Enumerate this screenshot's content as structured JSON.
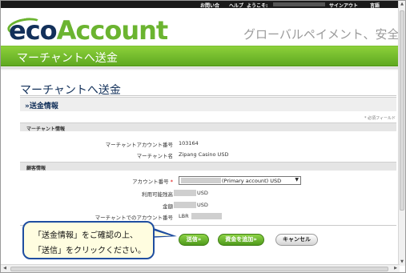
{
  "topbar": {
    "contact": "お問い合",
    "help": "ヘルプ",
    "welcome": "ようこそ:",
    "signout": "サインアウト",
    "language": "言語"
  },
  "logo": {
    "eco": "eco",
    "account": "Account"
  },
  "tagline": "グローバルペイメント、安全と簡",
  "banner_title": "マーチャントへ送金",
  "page_title": "マーチャントへ送金",
  "section_title": "»送金情報",
  "required_note": "* 必須フィールド",
  "merchant_info": {
    "heading": "マーチャント情報",
    "account_number_label": "マーチャントアカウント番号",
    "account_number_value": "103164",
    "name_label": "マーチャント名",
    "name_value": "Zipang Casino USD"
  },
  "customer_info": {
    "heading": "顧客情報",
    "account_label": "アカウント番号",
    "required_mark": "*",
    "account_select_value": "(Primary account) USD",
    "balance_label": "利用可能残高",
    "balance_currency": "USD",
    "amount_label": "金額",
    "amount_currency": "USD",
    "merchant_account_label": "マーチャントでのアカウント番号",
    "merchant_account_prefix": "LBR"
  },
  "buttons": {
    "send": "送信»",
    "add_funds": "資金を追加»",
    "cancel": "キャンセル"
  },
  "callout": {
    "line1": "「送金情報」をご確認の上、",
    "line2": "「送信」をクリックください。"
  },
  "colors": {
    "brand_navy": "#12305a",
    "brand_green": "#6bb430",
    "callout_border": "#1f4ea0",
    "callout_fill": "#fffde0"
  }
}
